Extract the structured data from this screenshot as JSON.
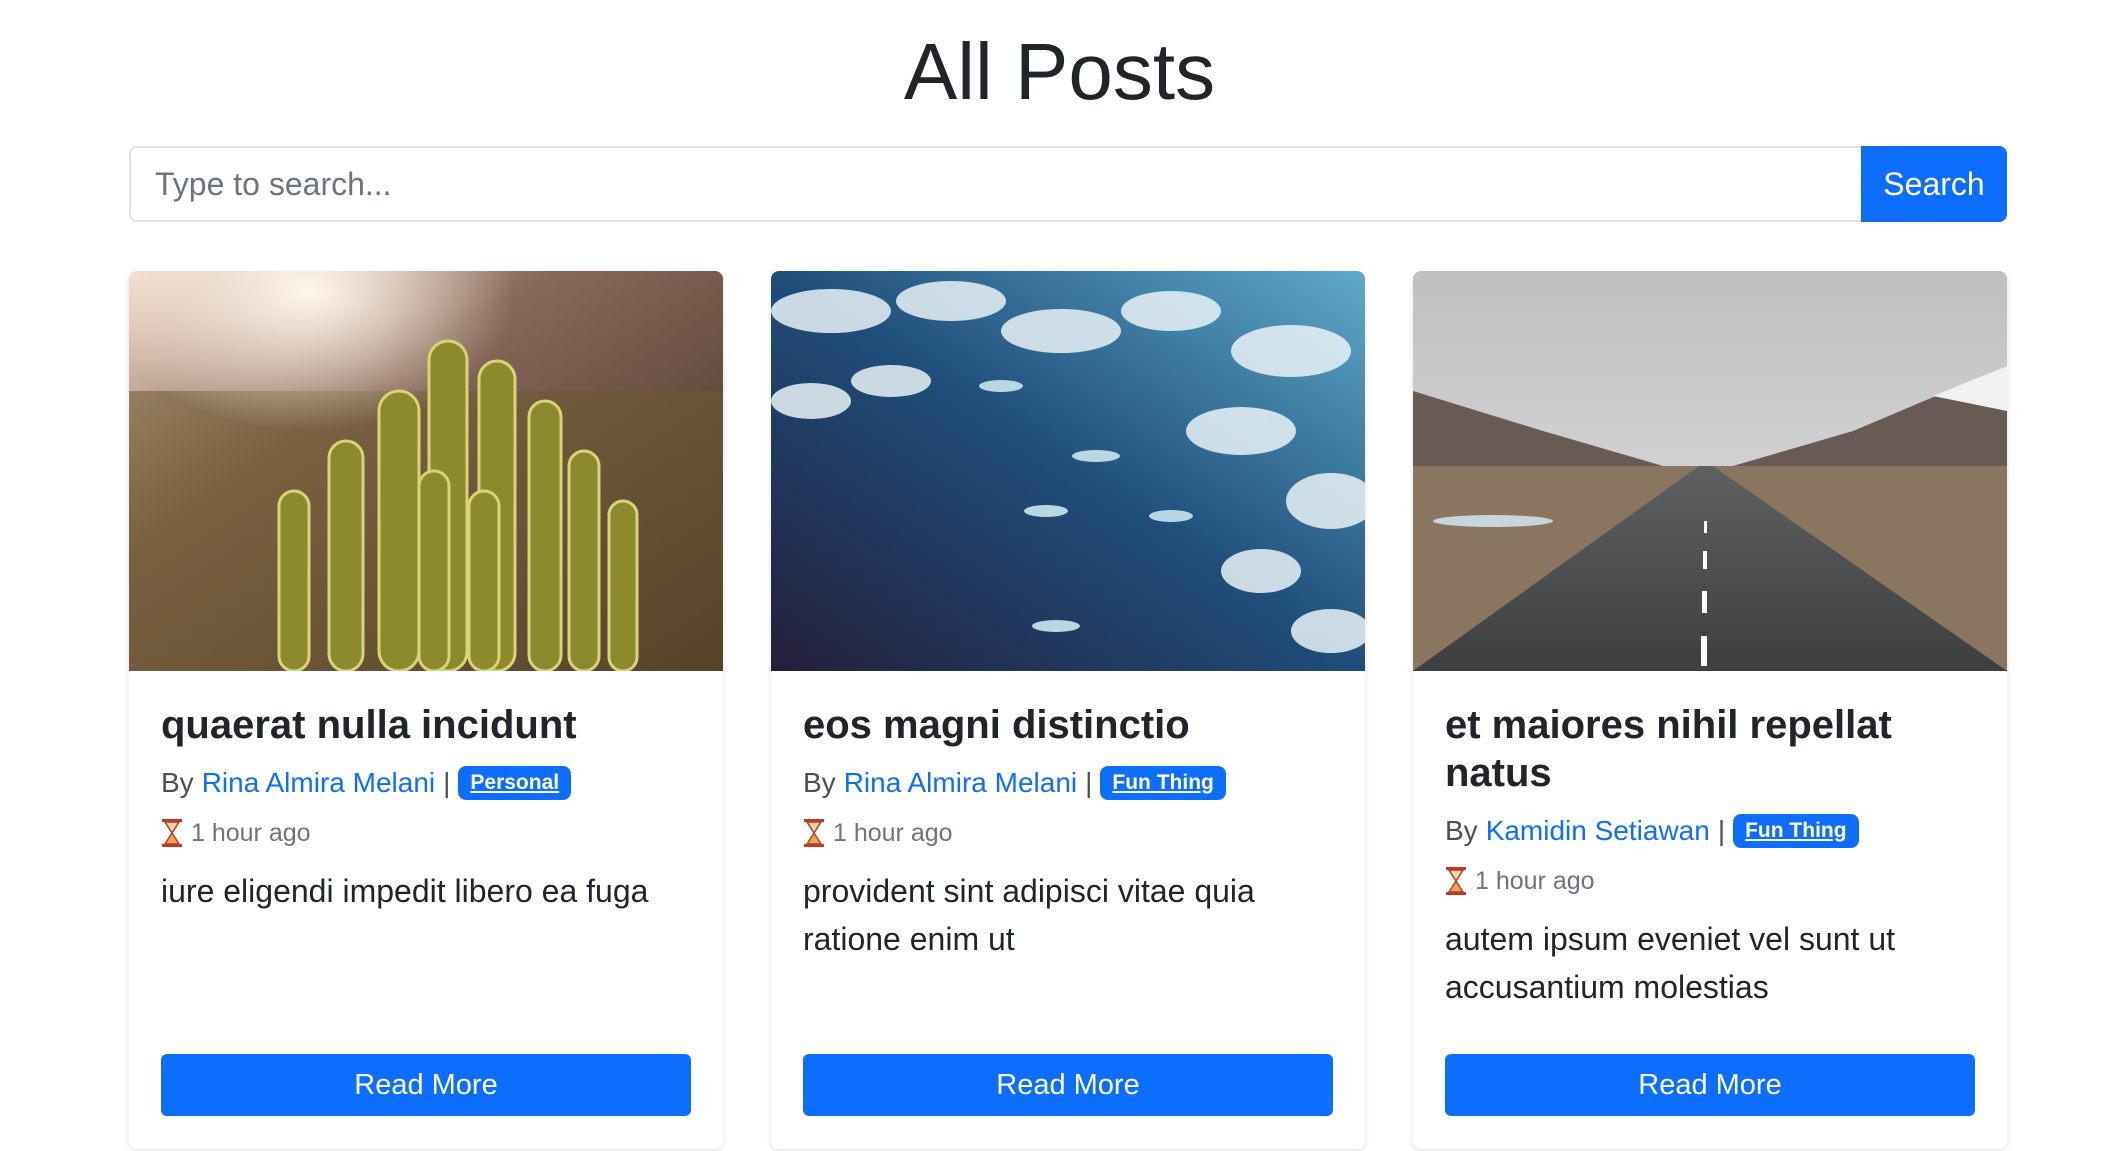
{
  "page": {
    "title": "All Posts"
  },
  "search": {
    "placeholder": "Type to search...",
    "button_label": "Search"
  },
  "posts": [
    {
      "title": "quaerat nulla incidunt",
      "by_prefix": "By",
      "author": "Rina Almira Melani",
      "separator": "|",
      "category": "Personal",
      "time_ago": "1 hour ago",
      "excerpt": "iure eligendi impedit libero ea fuga",
      "read_more_label": "Read More",
      "image_subject": "cactus"
    },
    {
      "title": "eos magni distinctio",
      "by_prefix": "By",
      "author": "Rina Almira Melani",
      "separator": "|",
      "category": "Fun Thing",
      "time_ago": "1 hour ago",
      "excerpt": "provident sint adipisci vitae quia ratione enim ut",
      "read_more_label": "Read More",
      "image_subject": "fish-in-water"
    },
    {
      "title": "et maiores nihil repellat natus",
      "by_prefix": "By",
      "author": "Kamidin Setiawan",
      "separator": "|",
      "category": "Fun Thing",
      "time_ago": "1 hour ago",
      "excerpt": "autem ipsum eveniet vel sunt ut accusantium molestias",
      "read_more_label": "Read More",
      "image_subject": "road"
    }
  ],
  "colors": {
    "primary": "#0d6efd",
    "text": "#212529",
    "muted": "#6c757d"
  },
  "icons": {
    "time": "hourglass-icon"
  }
}
